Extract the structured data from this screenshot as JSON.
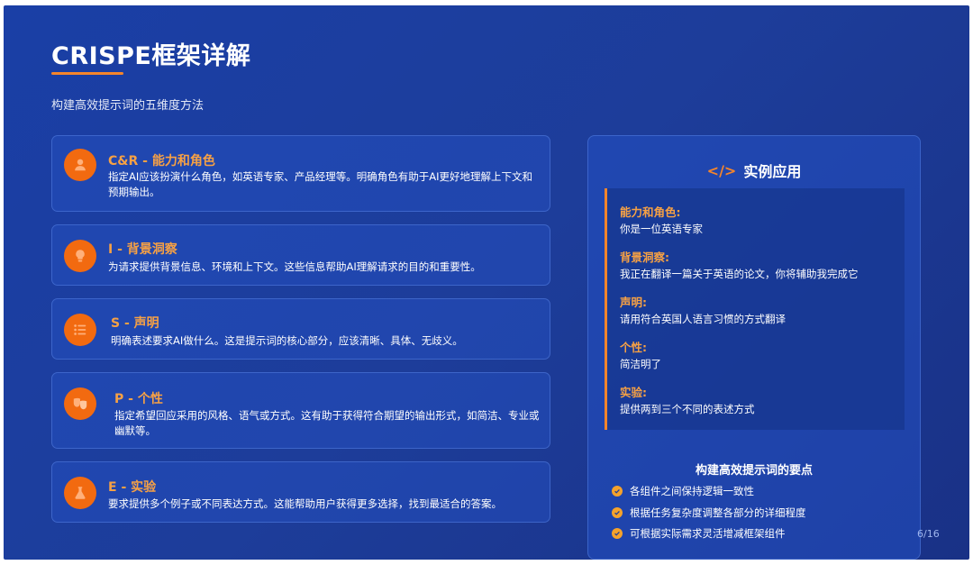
{
  "title": "CRISPE框架详解",
  "subtitle": "构建高效提示词的五维度方法",
  "cards": [
    {
      "icon": "user-icon",
      "title": "C&R - 能力和角色",
      "desc": "指定AI应该扮演什么角色，如英语专家、产品经理等。明确角色有助于AI更好地理解上下文和预期输出。"
    },
    {
      "icon": "lightbulb-icon",
      "title": "I - 背景洞察",
      "desc": "为请求提供背景信息、环境和上下文。这些信息帮助AI理解请求的目的和重要性。"
    },
    {
      "icon": "list-icon",
      "title": "S - 声明",
      "desc": "明确表述要求AI做什么。这是提示词的核心部分，应该清晰、具体、无歧义。"
    },
    {
      "icon": "masks-icon",
      "title": "P - 个性",
      "desc": "指定希望回应采用的风格、语气或方式。这有助于获得符合期望的输出形式，如简洁、专业或幽默等。"
    },
    {
      "icon": "flask-icon",
      "title": "E - 实验",
      "desc": "要求提供多个例子或不同表达方式。这能帮助用户获得更多选择，找到最适合的答案。"
    }
  ],
  "panel": {
    "icon": "code-icon",
    "code_glyph": "</>",
    "title": "实例应用",
    "examples": [
      {
        "label": "能力和角色:",
        "value": "你是一位英语专家"
      },
      {
        "label": "背景洞察:",
        "value": "我正在翻译一篇关于英语的论文，你将辅助我完成它"
      },
      {
        "label": "声明:",
        "value": "请用符合英国人语言习惯的方式翻译"
      },
      {
        "label": "个性:",
        "value": "简洁明了"
      },
      {
        "label": "实验:",
        "value": "提供两到三个不同的表述方式"
      }
    ],
    "tips_title": "构建高效提示词的要点",
    "tips": [
      "各组件之间保持逻辑一致性",
      "根据任务复杂度调整各部分的详细程度",
      "可根据实际需求灵活增减框架组件"
    ]
  },
  "page": "6/16",
  "colors": {
    "accent": "#f5852b",
    "badge": "#f26a10",
    "heading": "#f7a144",
    "background": "#1d3d9a"
  }
}
